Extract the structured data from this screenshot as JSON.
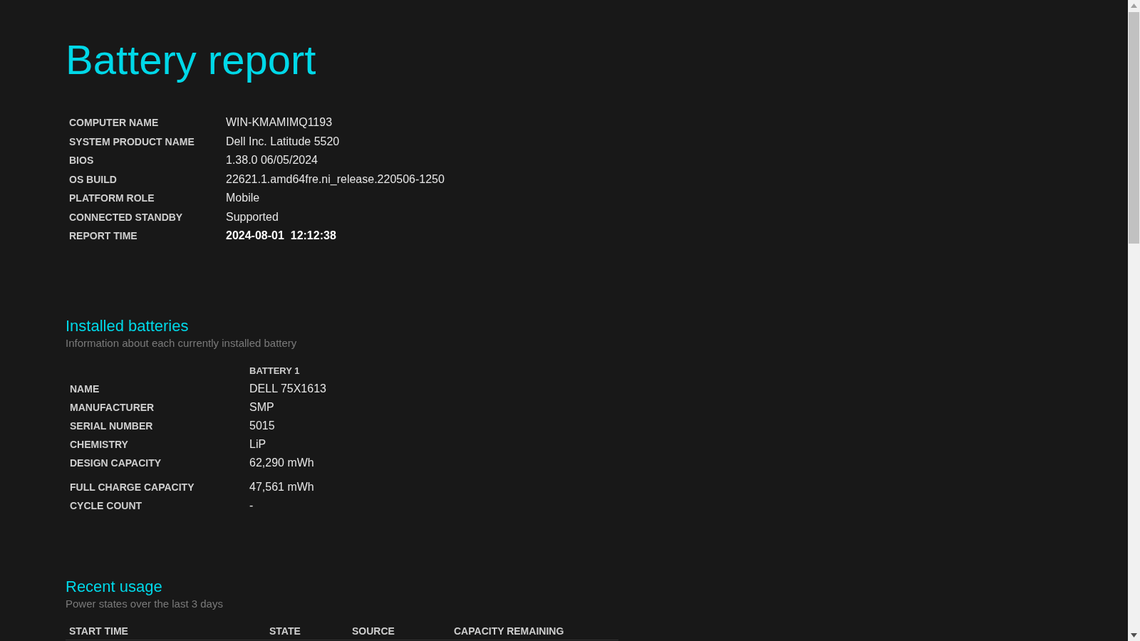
{
  "title": "Battery report",
  "system_info": [
    {
      "label": "COMPUTER NAME",
      "value": "WIN-KMAMIMQ1193",
      "emphasis": false
    },
    {
      "label": "SYSTEM PRODUCT NAME",
      "value": "Dell Inc. Latitude 5520",
      "emphasis": false
    },
    {
      "label": "BIOS",
      "value": "1.38.0 06/05/2024",
      "emphasis": false
    },
    {
      "label": "OS BUILD",
      "value": "22621.1.amd64fre.ni_release.220506-1250",
      "emphasis": false
    },
    {
      "label": "PLATFORM ROLE",
      "value": "Mobile",
      "emphasis": false
    },
    {
      "label": "CONNECTED STANDBY",
      "value": "Supported",
      "emphasis": false
    },
    {
      "label": "REPORT TIME",
      "value": "2024-08-01  12:12:38",
      "emphasis": true
    }
  ],
  "installed_batteries": {
    "heading": "Installed batteries",
    "subtitle": "Information about each currently installed battery",
    "column_header": "BATTERY 1",
    "rows": [
      {
        "label": "NAME",
        "value": "DELL 75X1613"
      },
      {
        "label": "MANUFACTURER",
        "value": "SMP"
      },
      {
        "label": "SERIAL NUMBER",
        "value": "5015"
      },
      {
        "label": "CHEMISTRY",
        "value": "LiP"
      },
      {
        "label": "DESIGN CAPACITY",
        "value": "62,290 mWh"
      },
      {
        "label": "FULL CHARGE CAPACITY",
        "value": "47,561 mWh"
      },
      {
        "label": "CYCLE COUNT",
        "value": "-"
      }
    ]
  },
  "recent_usage": {
    "heading": "Recent usage",
    "subtitle": "Power states over the last 3 days",
    "columns": [
      "START TIME",
      "STATE",
      "SOURCE",
      "CAPACITY REMAINING"
    ]
  }
}
